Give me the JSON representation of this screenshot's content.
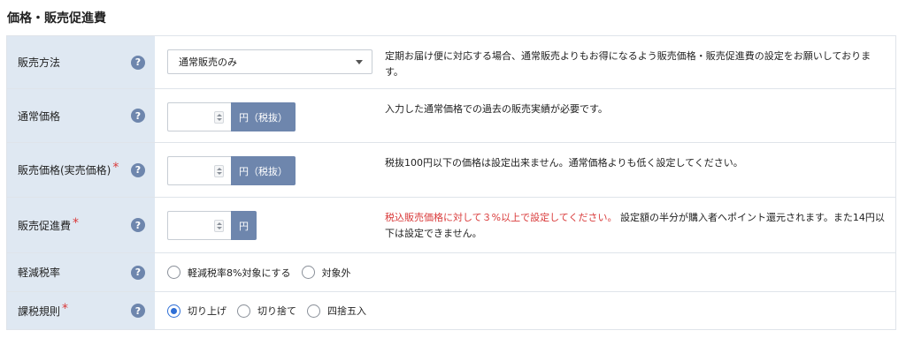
{
  "section_title": "価格・販売促進費",
  "rows": {
    "sales_method": {
      "label": "販売方法",
      "select_value": "通常販売のみ",
      "note": "定期お届け便に対応する場合、通常販売よりもお得になるよう販売価格・販売促進費の設定をお願いしております。"
    },
    "regular_price": {
      "label": "通常価格",
      "input_value": "",
      "unit": "円（税抜）",
      "note": "入力した通常価格での過去の販売実績が必要です。"
    },
    "sale_price": {
      "label": "販売価格(実売価格)",
      "required": "*",
      "input_value": "",
      "unit": "円（税抜）",
      "note": "税抜100円以下の価格は設定出来ません。通常価格よりも低く設定してください。"
    },
    "promo_cost": {
      "label": "販売促進費",
      "required": "*",
      "input_value": "",
      "unit": "円",
      "note_warn": "税込販売価格に対して３%以上で設定してください。",
      "note_rest": "設定額の半分が購入者へポイント還元されます。また14円以下は設定できません。"
    },
    "reduced_tax": {
      "label": "軽減税率",
      "options": [
        "軽減税率8%対象にする",
        "対象外"
      ],
      "selected": -1
    },
    "tax_rounding": {
      "label": "課税規則",
      "required": "*",
      "options": [
        "切り上げ",
        "切り捨て",
        "四捨五入"
      ],
      "selected": 0
    }
  },
  "help_glyph": "?",
  "icons": {
    "help": "question-circle-icon",
    "dropdown": "chevron-down-icon",
    "spinner": "spinner-icon"
  },
  "colors": {
    "label_bg": "#dfe8f2",
    "accent": "#6e86ad",
    "required": "#d93a3a",
    "radio_checked": "#2f6fd6"
  }
}
